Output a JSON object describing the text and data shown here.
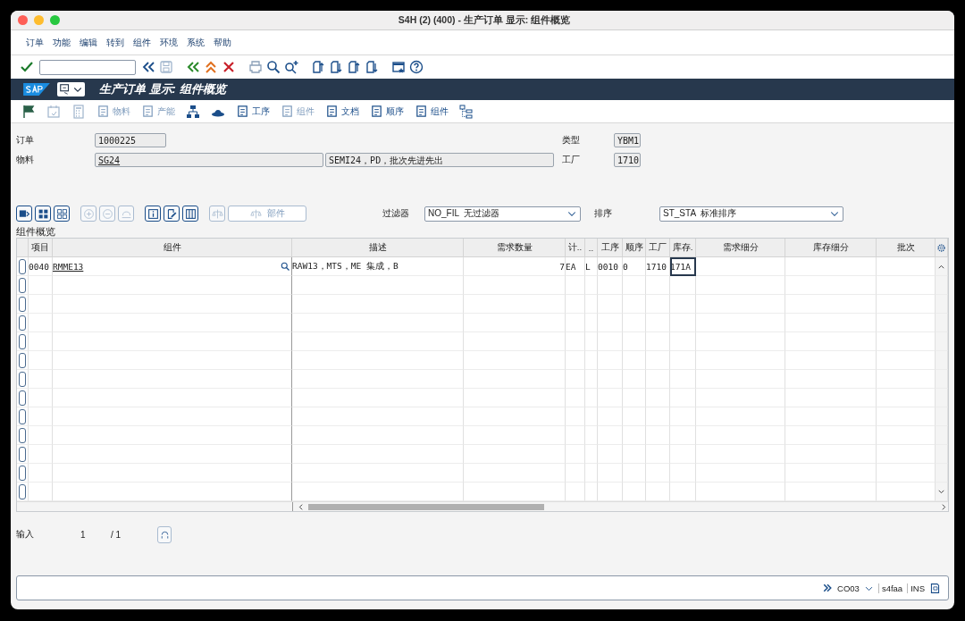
{
  "window": {
    "title": "S4H (2) (400) - 生产订单 显示: 组件概览"
  },
  "menu": [
    "订单",
    "功能",
    "编辑",
    "转到",
    "组件",
    "环境",
    "系统",
    "帮助"
  ],
  "screen_title": "生产订单 显示: 组件概览",
  "app_toolbar": [
    {
      "label": "物料",
      "disabled": true
    },
    {
      "label": "产能",
      "disabled": true
    },
    {
      "label": "工序",
      "disabled": false
    },
    {
      "label": "组件",
      "disabled": true
    },
    {
      "label": "文档",
      "disabled": false
    },
    {
      "label": "顺序",
      "disabled": false
    },
    {
      "label": "组件",
      "disabled": false
    }
  ],
  "header": {
    "order_label": "订单",
    "order": "1000225",
    "material_label": "物料",
    "material": "SG24",
    "material_desc": "SEMI24，PD，批次先进先出",
    "type_label": "类型",
    "type": "YBM1",
    "plant_label": "工厂",
    "plant": "1710"
  },
  "table_toolbar": {
    "parts_button": "部件",
    "filter_label": "过滤器",
    "filter": "NO_FIL  无过滤器",
    "sort_label": "排序",
    "sort": "ST_STA  标准排序"
  },
  "table": {
    "title": "组件概览",
    "columns": [
      "项目",
      "组件",
      "描述",
      "需求数量",
      "计..",
      "..",
      "工序",
      "顺序",
      "工厂",
      "库存.",
      "需求细分",
      "库存细分",
      "批次"
    ],
    "rows": [
      {
        "cells": [
          {
            "text": "0040",
            "focused": false
          },
          {
            "text": "RMME13",
            "focused": false
          },
          {
            "text": "RAW13，MTS，ME 集成，B",
            "focused": false
          },
          {
            "text": "7",
            "focused": false
          },
          {
            "text": "EA",
            "focused": false
          },
          {
            "text": "L",
            "focused": false
          },
          {
            "text": "0010",
            "focused": false
          },
          {
            "text": "0",
            "focused": false
          },
          {
            "text": "1710",
            "focused": false
          },
          {
            "text": "171A",
            "focused": true
          }
        ]
      }
    ]
  },
  "footer": {
    "entry_label": "输入",
    "entry": "1",
    "total": "/ 1"
  },
  "status_bar": {
    "transaction": "CO03",
    "server": "s4faa",
    "mode": "INS"
  }
}
